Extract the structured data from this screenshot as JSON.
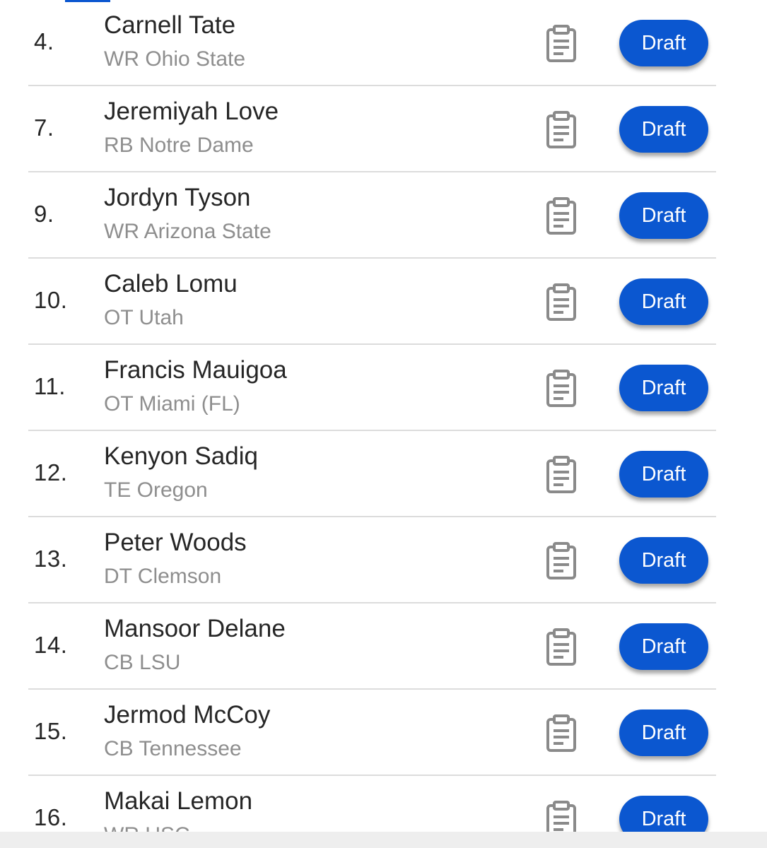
{
  "players": [
    {
      "rank": "4.",
      "name": "Carnell Tate",
      "school": "WR Ohio State"
    },
    {
      "rank": "7.",
      "name": "Jeremiyah Love",
      "school": "RB Notre Dame"
    },
    {
      "rank": "9.",
      "name": "Jordyn Tyson",
      "school": "WR Arizona State"
    },
    {
      "rank": "10.",
      "name": "Caleb Lomu",
      "school": "OT Utah"
    },
    {
      "rank": "11.",
      "name": "Francis Mauigoa",
      "school": "OT Miami (FL)"
    },
    {
      "rank": "12.",
      "name": "Kenyon Sadiq",
      "school": "TE Oregon"
    },
    {
      "rank": "13.",
      "name": "Peter Woods",
      "school": "DT Clemson"
    },
    {
      "rank": "14.",
      "name": "Mansoor Delane",
      "school": "CB LSU"
    },
    {
      "rank": "15.",
      "name": "Jermod McCoy",
      "school": "CB Tennessee"
    },
    {
      "rank": "16.",
      "name": "Makai Lemon",
      "school": "WR USC"
    }
  ],
  "actions": {
    "draft_label": "Draft",
    "notes_icon": "clipboard-icon"
  },
  "colors": {
    "accent": "#0b57d0",
    "text_primary": "#262626",
    "text_secondary": "#8e8e8e",
    "divider": "#dcdcdc",
    "icon": "#8a8a8a"
  }
}
